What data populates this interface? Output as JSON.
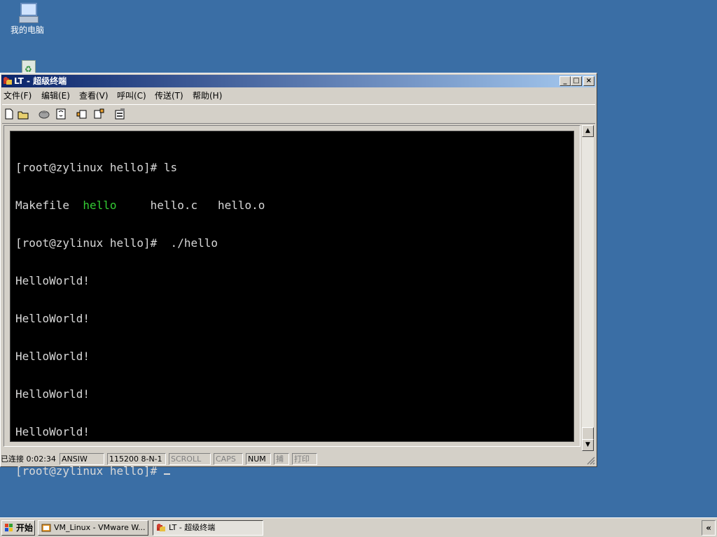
{
  "desktop": {
    "icons": [
      {
        "label": "我的电脑",
        "icon": "my-computer-icon"
      },
      {
        "label": "",
        "icon": "recycle-bin-icon"
      }
    ]
  },
  "window": {
    "title": "LT - 超级终端",
    "controls": {
      "minimize": "_",
      "maximize": "□",
      "close": "×"
    },
    "menu": [
      {
        "label": "文件(F)"
      },
      {
        "label": "编辑(E)"
      },
      {
        "label": "查看(V)"
      },
      {
        "label": "呼叫(C)"
      },
      {
        "label": "传送(T)"
      },
      {
        "label": "帮助(H)"
      }
    ],
    "toolbar": [
      "new-icon",
      "open-icon",
      "disconnect-icon",
      "call-icon",
      "send-icon",
      "receive-icon",
      "properties-icon"
    ]
  },
  "terminal": {
    "lines": {
      "l1": "[root@zylinux hello]# ls",
      "l2a": "Makefile  ",
      "l2b": "hello",
      "l2c": "     hello.c   hello.o",
      "l3": "[root@zylinux hello]#  ./hello",
      "l4": "HelloWorld!",
      "l5": "HelloWorld!",
      "l6": "HelloWorld!",
      "l7": "HelloWorld!",
      "l8": "HelloWorld!",
      "l9": "[root@zylinux hello]# "
    },
    "colors": {
      "background": "#000000",
      "text": "#d8d8d8",
      "executable": "#33cc33"
    }
  },
  "statusbar": {
    "connected": "已连接 0:02:34",
    "emulation": "ANSIW",
    "settings": "115200 8-N-1",
    "scroll": "SCROLL",
    "caps": "CAPS",
    "num": "NUM",
    "capture": "捕",
    "print": "打印"
  },
  "taskbar": {
    "start": "开始",
    "tasks": [
      {
        "label": "VM_Linux - VMware W...",
        "active": false
      },
      {
        "label": "LT - 超级终端",
        "active": true
      }
    ],
    "tray_arrow": "«"
  },
  "colors": {
    "desktop": "#3a6ea5",
    "titlebar_start": "#0a246a",
    "titlebar_end": "#a6caf0",
    "chrome": "#d4d0c8"
  }
}
